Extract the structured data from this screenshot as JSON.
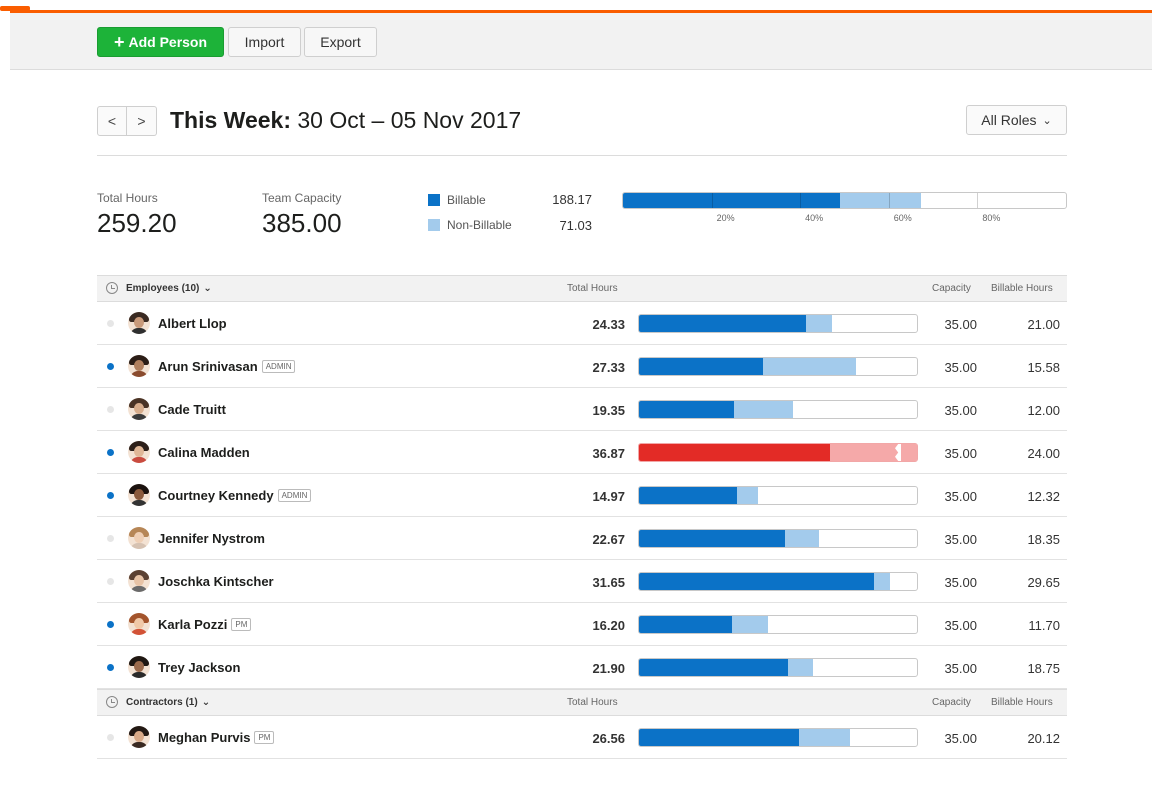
{
  "toolbar": {
    "add_person_label": "Add Person",
    "import_label": "Import",
    "export_label": "Export"
  },
  "week": {
    "prefix": "This Week:",
    "range": "30 Oct – 05 Nov 2017",
    "prev_label": "<",
    "next_label": ">"
  },
  "roles_filter": {
    "label": "All Roles",
    "chevron": "⌄"
  },
  "summary": {
    "total_hours_label": "Total Hours",
    "total_hours": "259.20",
    "team_capacity_label": "Team Capacity",
    "team_capacity": "385.00",
    "billable_label": "Billable",
    "billable_value": "188.17",
    "non_billable_label": "Non-Billable",
    "non_billable_value": "71.03",
    "tick_labels": [
      "20%",
      "40%",
      "60%",
      "80%"
    ],
    "billable_fraction": 0.489,
    "non_billable_fraction": 0.184
  },
  "colors": {
    "billable": "#0b72c7",
    "non_billable": "#a3cbec",
    "over_billable": "#e32b26",
    "over_non_billable": "#f5a9a9",
    "active_dot": "#0b72c7",
    "add_button": "#1db339",
    "accent": "#fa5d00"
  },
  "sections": [
    {
      "title": "Employees (10)",
      "col_total": "Total Hours",
      "col_capacity": "Capacity",
      "col_billable": "Billable Hours",
      "people": [
        {
          "name": "Albert Llop",
          "badge": "",
          "active": false,
          "total": "24.33",
          "capacity": "35.00",
          "billable": "21.00",
          "billable_fraction": 0.6,
          "non_billable_fraction": 0.095,
          "over": false
        },
        {
          "name": "Arun Srinivasan",
          "badge": "ADMIN",
          "active": true,
          "total": "27.33",
          "capacity": "35.00",
          "billable": "15.58",
          "billable_fraction": 0.445,
          "non_billable_fraction": 0.335,
          "over": false
        },
        {
          "name": "Cade Truitt",
          "badge": "",
          "active": false,
          "total": "19.35",
          "capacity": "35.00",
          "billable": "12.00",
          "billable_fraction": 0.343,
          "non_billable_fraction": 0.21,
          "over": false
        },
        {
          "name": "Calina Madden",
          "badge": "",
          "active": true,
          "total": "36.87",
          "capacity": "35.00",
          "billable": "24.00",
          "billable_fraction": 0.686,
          "non_billable_fraction": 0.314,
          "over": true
        },
        {
          "name": "Courtney Kennedy",
          "badge": "ADMIN",
          "active": true,
          "total": "14.97",
          "capacity": "35.00",
          "billable": "12.32",
          "billable_fraction": 0.352,
          "non_billable_fraction": 0.076,
          "over": false
        },
        {
          "name": "Jennifer Nystrom",
          "badge": "",
          "active": false,
          "total": "22.67",
          "capacity": "35.00",
          "billable": "18.35",
          "billable_fraction": 0.524,
          "non_billable_fraction": 0.124,
          "over": false
        },
        {
          "name": "Joschka Kintscher",
          "badge": "",
          "active": false,
          "total": "31.65",
          "capacity": "35.00",
          "billable": "29.65",
          "billable_fraction": 0.847,
          "non_billable_fraction": 0.057,
          "over": false
        },
        {
          "name": "Karla Pozzi",
          "badge": "PM",
          "active": true,
          "total": "16.20",
          "capacity": "35.00",
          "billable": "11.70",
          "billable_fraction": 0.334,
          "non_billable_fraction": 0.129,
          "over": false
        },
        {
          "name": "Trey Jackson",
          "badge": "",
          "active": true,
          "total": "21.90",
          "capacity": "35.00",
          "billable": "18.75",
          "billable_fraction": 0.536,
          "non_billable_fraction": 0.09,
          "over": false
        }
      ]
    },
    {
      "title": "Contractors (1)",
      "col_total": "Total Hours",
      "col_capacity": "Capacity",
      "col_billable": "Billable Hours",
      "people": [
        {
          "name": "Meghan Purvis",
          "badge": "PM",
          "active": false,
          "total": "26.56",
          "capacity": "35.00",
          "billable": "20.12",
          "billable_fraction": 0.575,
          "non_billable_fraction": 0.184,
          "over": false
        }
      ]
    }
  ]
}
